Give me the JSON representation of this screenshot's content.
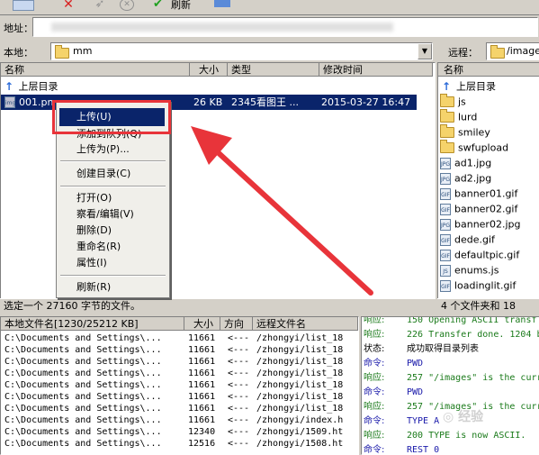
{
  "toolbar": {
    "refresh_label": "刷新"
  },
  "address": {
    "label": "地址："
  },
  "local": {
    "label": "本地：",
    "path": "mm",
    "columns": [
      "名称",
      "大小",
      "类型",
      "修改时间"
    ],
    "up_item": "上层目录",
    "file": {
      "name": "001.pn",
      "size": "26 KB",
      "type": "2345看图王 ...",
      "modified": "2015-03-27 16:47"
    },
    "status": "选定一个 27160 字节的文件。"
  },
  "remote": {
    "label": "远程：",
    "path": "/image",
    "column": "名称",
    "up_item": "上层目录",
    "items": [
      {
        "name": "js",
        "icon": "folder-icon"
      },
      {
        "name": "lurd",
        "icon": "folder-icon"
      },
      {
        "name": "smiley",
        "icon": "folder-icon"
      },
      {
        "name": "swfupload",
        "icon": "folder-icon"
      },
      {
        "name": "ad1.jpg",
        "icon": "jpg-file-icon"
      },
      {
        "name": "ad2.jpg",
        "icon": "jpg-file-icon"
      },
      {
        "name": "banner01.gif",
        "icon": "gif-file-icon"
      },
      {
        "name": "banner02.gif",
        "icon": "gif-file-icon"
      },
      {
        "name": "banner02.jpg",
        "icon": "jpg-file-icon"
      },
      {
        "name": "dede.gif",
        "icon": "gif-file-icon"
      },
      {
        "name": "defaultpic.gif",
        "icon": "gif-file-icon"
      },
      {
        "name": "enums.js",
        "icon": "js-file-icon"
      },
      {
        "name": "loadinglit.gif",
        "icon": "gif-file-icon"
      }
    ],
    "status": "4 个文件夹和 18"
  },
  "context_menu": {
    "items": [
      "上传(U)",
      "添加到队列(Q)",
      "上传为(P)...",
      "创建目录(C)",
      "打开(O)",
      "察看/编辑(V)",
      "删除(D)",
      "重命名(R)",
      "属性(I)",
      "刷新(R)"
    ]
  },
  "queue": {
    "columns": [
      "本地文件名[1230/25212 KB]",
      "大小",
      "方向",
      "远程文件名"
    ],
    "rows": [
      {
        "local": "C:\\Documents and Settings\\...",
        "size": "11661",
        "dir": "<---",
        "remote": "/zhongyi/list_18"
      },
      {
        "local": "C:\\Documents and Settings\\...",
        "size": "11661",
        "dir": "<---",
        "remote": "/zhongyi/list_18"
      },
      {
        "local": "C:\\Documents and Settings\\...",
        "size": "11661",
        "dir": "<---",
        "remote": "/zhongyi/list_18"
      },
      {
        "local": "C:\\Documents and Settings\\...",
        "size": "11661",
        "dir": "<---",
        "remote": "/zhongyi/list_18"
      },
      {
        "local": "C:\\Documents and Settings\\...",
        "size": "11661",
        "dir": "<---",
        "remote": "/zhongyi/list_18"
      },
      {
        "local": "C:\\Documents and Settings\\...",
        "size": "11661",
        "dir": "<---",
        "remote": "/zhongyi/list_18"
      },
      {
        "local": "C:\\Documents and Settings\\...",
        "size": "11661",
        "dir": "<---",
        "remote": "/zhongyi/list_18"
      },
      {
        "local": "C:\\Documents and Settings\\...",
        "size": "11661",
        "dir": "<---",
        "remote": "/zhongyi/index.h"
      },
      {
        "local": "C:\\Documents and Settings\\...",
        "size": "12340",
        "dir": "<---",
        "remote": "/zhongyi/1509.ht"
      },
      {
        "local": "C:\\Documents and Settings\\...",
        "size": "12516",
        "dir": "<---",
        "remote": "/zhongyi/1508.ht"
      }
    ]
  },
  "log": {
    "rows": [
      {
        "label": "响应:",
        "text": "150 Opening ASCII transf",
        "color": "#1a7a1a"
      },
      {
        "label": "响应:",
        "text": "226 Transfer done. 1204 b",
        "color": "#1a7a1a"
      },
      {
        "label": "状态:",
        "text": "成功取得目录列表",
        "color": "#000000"
      },
      {
        "label": "命令:",
        "text": "PWD",
        "color": "#1a1aaa"
      },
      {
        "label": "响应:",
        "text": "257 \"/images\" is the curr",
        "color": "#1a7a1a"
      },
      {
        "label": "命令:",
        "text": "PWD",
        "color": "#1a1aaa"
      },
      {
        "label": "响应:",
        "text": "257 \"/images\" is the curr",
        "color": "#1a7a1a"
      },
      {
        "label": "命令:",
        "text": "TYPE A",
        "color": "#1a1aaa"
      },
      {
        "label": "响应:",
        "text": "200 TYPE is now ASCII.",
        "color": "#1a7a1a"
      },
      {
        "label": "命令:",
        "text": "REST 0",
        "color": "#1a1aaa"
      }
    ]
  },
  "colors": {
    "highlight": "#0a246a",
    "callout": "#e8343a"
  }
}
